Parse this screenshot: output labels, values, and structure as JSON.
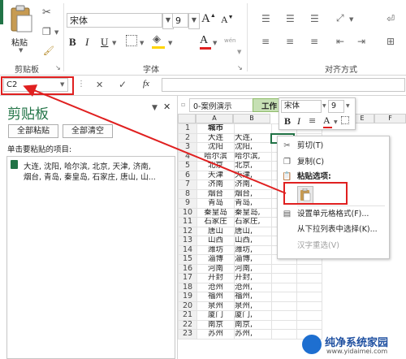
{
  "ribbon": {
    "clipboard": {
      "paste_label": "粘贴",
      "group_label": "剪贴板"
    },
    "font": {
      "name": "宋体",
      "size": "9",
      "grow": "A",
      "shrink": "A",
      "bold": "B",
      "italic": "I",
      "underline": "U",
      "font_color": "A",
      "wen": "wén",
      "group_label": "字体"
    },
    "alignment": {
      "group_label": "对齐方式"
    },
    "colors": {
      "excel_green": "#217346",
      "font_color_red": "#e02020"
    }
  },
  "formula_bar": {
    "name_box": "C2",
    "cancel": "✕",
    "enter": "✓",
    "fx": "fx"
  },
  "clipboard_pane": {
    "title": "剪贴板",
    "paste_all": "全部粘贴",
    "clear_all": "全部清空",
    "hint": "单击要粘贴的项目:",
    "item_line1": "大连, 沈阳, 哈尔滨, 北京, 天津, 济南,",
    "item_line2": "烟台, 青岛, 秦皇岛, 石家庄, 唐山, 山..."
  },
  "sheet": {
    "tabs": [
      "0-案例演示",
      "工作"
    ],
    "columns": [
      "A",
      "B",
      "E",
      "F"
    ],
    "header_cell": "城市",
    "rows": [
      {
        "n": "1",
        "a": "城市",
        "b": ""
      },
      {
        "n": "2",
        "a": "大连",
        "b": "大连,"
      },
      {
        "n": "3",
        "a": "沈阳",
        "b": "沈阳,"
      },
      {
        "n": "4",
        "a": "哈尔滨",
        "b": "哈尔滨,"
      },
      {
        "n": "5",
        "a": "北京",
        "b": "北京,"
      },
      {
        "n": "6",
        "a": "天津",
        "b": "天津,"
      },
      {
        "n": "7",
        "a": "济南",
        "b": "济南,"
      },
      {
        "n": "8",
        "a": "烟台",
        "b": "烟台,"
      },
      {
        "n": "9",
        "a": "青岛",
        "b": "青岛,"
      },
      {
        "n": "10",
        "a": "秦皇岛",
        "b": "秦皇岛,"
      },
      {
        "n": "11",
        "a": "石家庄",
        "b": "石家庄,"
      },
      {
        "n": "12",
        "a": "唐山",
        "b": "唐山,"
      },
      {
        "n": "13",
        "a": "山西",
        "b": "山西,"
      },
      {
        "n": "14",
        "a": "潍坊",
        "b": "潍坊,"
      },
      {
        "n": "15",
        "a": "淄博",
        "b": "淄博,"
      },
      {
        "n": "16",
        "a": "河南",
        "b": "河南,"
      },
      {
        "n": "17",
        "a": "开封",
        "b": "开封,"
      },
      {
        "n": "18",
        "a": "沧州",
        "b": "沧州,"
      },
      {
        "n": "19",
        "a": "福州",
        "b": "福州,"
      },
      {
        "n": "20",
        "a": "泉州",
        "b": "泉州,"
      },
      {
        "n": "21",
        "a": "厦门",
        "b": "厦门,"
      },
      {
        "n": "22",
        "a": "南京",
        "b": "南京,"
      },
      {
        "n": "23",
        "a": "苏州",
        "b": "苏州,"
      }
    ]
  },
  "mini_toolbar": {
    "font": "宋体",
    "size": "9",
    "bold": "B",
    "italic": "I",
    "align": "≡",
    "font_color": "A"
  },
  "context_menu": {
    "cut": "剪切(T)",
    "copy": "复制(C)",
    "paste_options": "粘贴选项:",
    "format_cells": "设置单元格格式(F)...",
    "pick_list": "从下拉列表中选择(K)...",
    "hanzi": "汉字重选(V)"
  },
  "watermark": {
    "title": "纯净系统家园",
    "url": "www.yidaimei.com"
  }
}
